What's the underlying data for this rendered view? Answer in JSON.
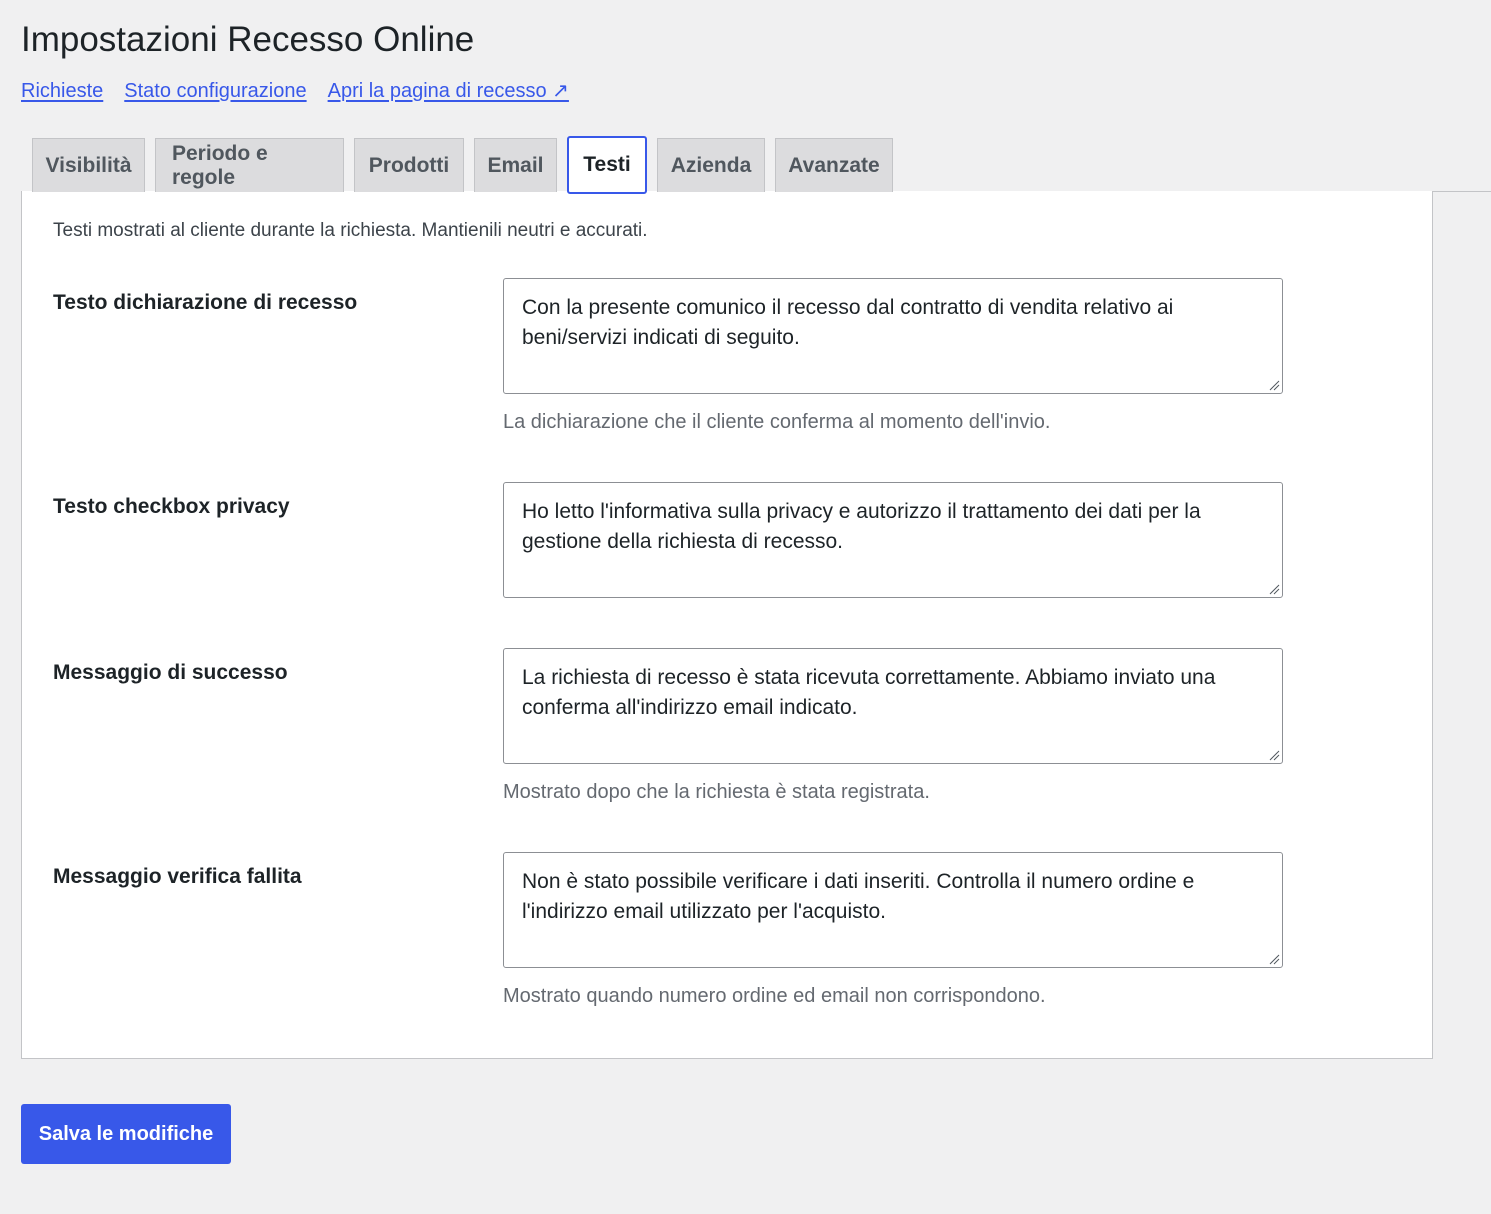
{
  "header": {
    "title": "Impostazioni Recesso Online"
  },
  "subnav": {
    "links": [
      {
        "label": "Richieste"
      },
      {
        "label": "Stato configurazione"
      },
      {
        "label": "Apri la pagina di recesso ↗"
      }
    ]
  },
  "tabs": [
    {
      "label": "Visibilità",
      "active": false
    },
    {
      "label": "Periodo e regole",
      "active": false
    },
    {
      "label": "Prodotti",
      "active": false
    },
    {
      "label": "Email",
      "active": false
    },
    {
      "label": "Testi",
      "active": true
    },
    {
      "label": "Azienda",
      "active": false
    },
    {
      "label": "Avanzate",
      "active": false
    }
  ],
  "panel": {
    "intro": "Testi mostrati al cliente durante la richiesta. Mantienili neutri e accurati.",
    "fields": [
      {
        "label": "Testo dichiarazione di recesso",
        "value": "Con la presente comunico il recesso dal contratto di vendita relativo ai beni/servizi indicati di seguito.",
        "help": "La dichiarazione che il cliente conferma al momento dell'invio."
      },
      {
        "label": "Testo checkbox privacy",
        "value": "Ho letto l'informativa sulla privacy e autorizzo il trattamento dei dati per la gestione della richiesta di recesso.",
        "help": ""
      },
      {
        "label": "Messaggio di successo",
        "value": "La richiesta di recesso è stata ricevuta correttamente. Abbiamo inviato una conferma all'indirizzo email indicato.",
        "help": "Mostrato dopo che la richiesta è stata registrata."
      },
      {
        "label": "Messaggio verifica fallita",
        "value": "Non è stato possibile verificare i dati inseriti. Controlla il numero ordine e l'indirizzo email utilizzato per l'acquisto.",
        "help": "Mostrato quando numero ordine ed email non corrispondono."
      }
    ]
  },
  "actions": {
    "save_label": "Salva le modifiche"
  },
  "colors": {
    "accent": "#3858e9",
    "background": "#f0f0f1",
    "panel": "#ffffff",
    "help_text": "#646970"
  }
}
